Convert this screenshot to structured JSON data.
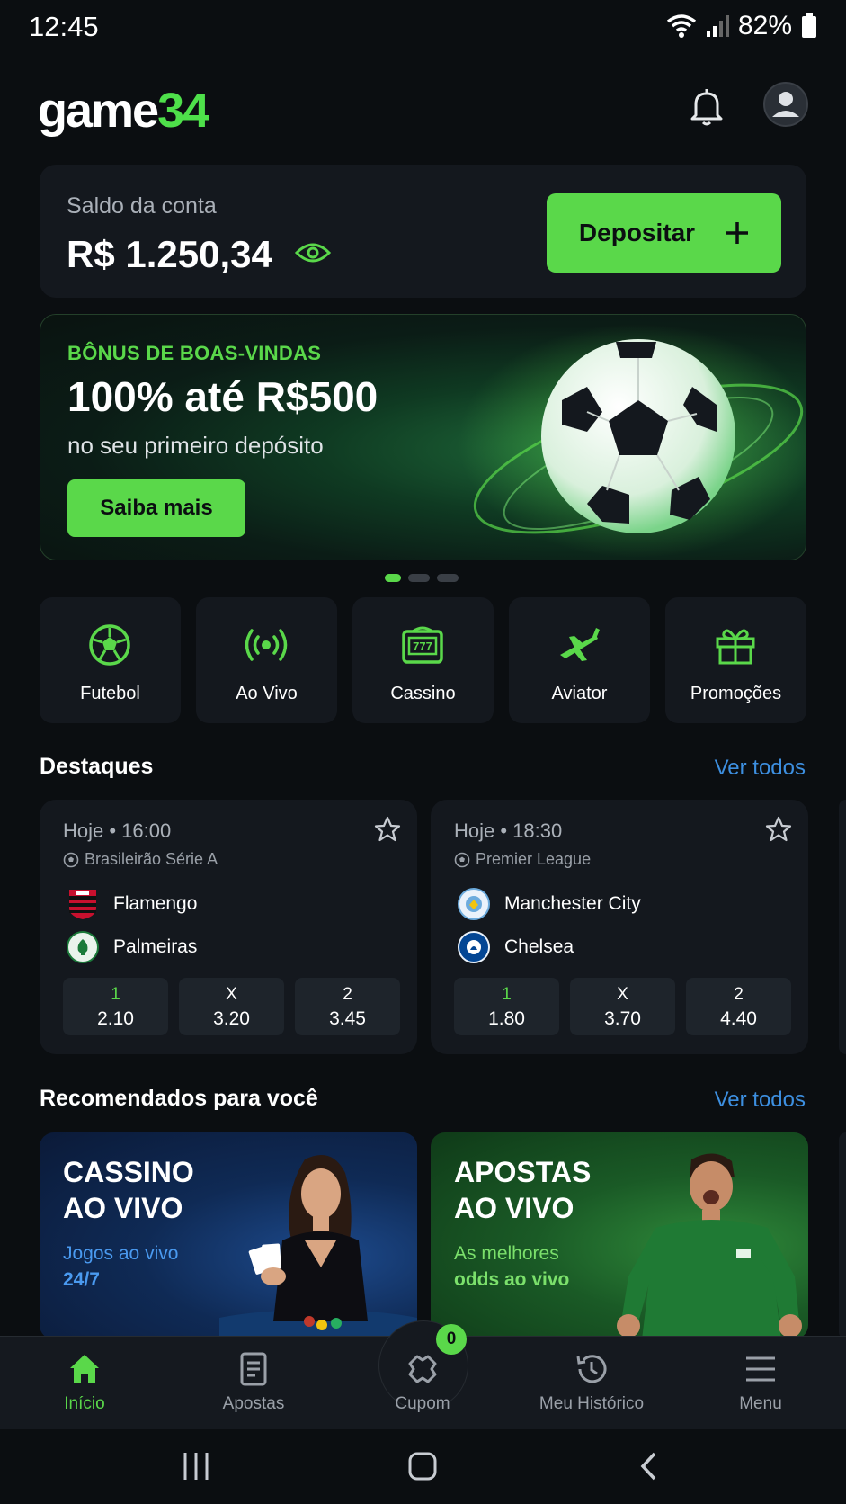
{
  "status_bar": {
    "time": "12:45",
    "battery": "82%"
  },
  "header": {
    "logo_text": "game",
    "logo_num": "34"
  },
  "balance": {
    "label": "Saldo da conta",
    "value": "R$ 1.250,34",
    "deposit_label": "Depositar"
  },
  "promo": {
    "kicker": "BÔNUS DE BOAS-VINDAS",
    "title": "100% até R$500",
    "subtitle": "no seu primeiro depósito",
    "button": "Saiba mais",
    "slide_count": 3,
    "active_slide": 1
  },
  "categories": [
    {
      "label": "Futebol",
      "icon": "soccer-ball-icon"
    },
    {
      "label": "Ao Vivo",
      "icon": "live-broadcast-icon"
    },
    {
      "label": "Cassino",
      "icon": "slot-machine-icon"
    },
    {
      "label": "Aviator",
      "icon": "airplane-icon"
    },
    {
      "label": "Promoções",
      "icon": "gift-icon"
    }
  ],
  "highlights": {
    "title": "Destaques",
    "see_all": "Ver todos",
    "matches": [
      {
        "time": "Hoje • 16:00",
        "league": "Brasileirão Série A",
        "home": "Flamengo",
        "away": "Palmeiras",
        "odds": [
          {
            "key": "1",
            "value": "2.10"
          },
          {
            "key": "X",
            "value": "3.20"
          },
          {
            "key": "2",
            "value": "3.45"
          }
        ]
      },
      {
        "time": "Hoje • 18:30",
        "league": "Premier League",
        "home": "Manchester City",
        "away": "Chelsea",
        "odds": [
          {
            "key": "1",
            "value": "1.80"
          },
          {
            "key": "X",
            "value": "3.70"
          },
          {
            "key": "2",
            "value": "4.40"
          }
        ]
      }
    ]
  },
  "recommended": {
    "title": "Recomendados para você",
    "see_all": "Ver todos",
    "cards": [
      {
        "title_line1": "CASSINO",
        "title_line2": "AO VIVO",
        "sub_line1": "Jogos ao vivo",
        "sub_line2": "24/7"
      },
      {
        "title_line1": "APOSTAS",
        "title_line2": "AO VIVO",
        "sub_line1": "As melhores",
        "sub_line2": "odds ao vivo"
      }
    ]
  },
  "bottom_nav": {
    "items": [
      {
        "label": "Início",
        "icon": "home-icon",
        "active": true
      },
      {
        "label": "Apostas",
        "icon": "document-icon"
      },
      {
        "label": "Cupom",
        "icon": "coupon-icon",
        "badge": "0"
      },
      {
        "label": "Meu Histórico",
        "icon": "history-icon"
      },
      {
        "label": "Menu",
        "icon": "menu-icon"
      }
    ]
  },
  "colors": {
    "accent": "#5ad84a",
    "background": "#0b0e11",
    "card": "#14181e",
    "link": "#3d8fe0"
  }
}
